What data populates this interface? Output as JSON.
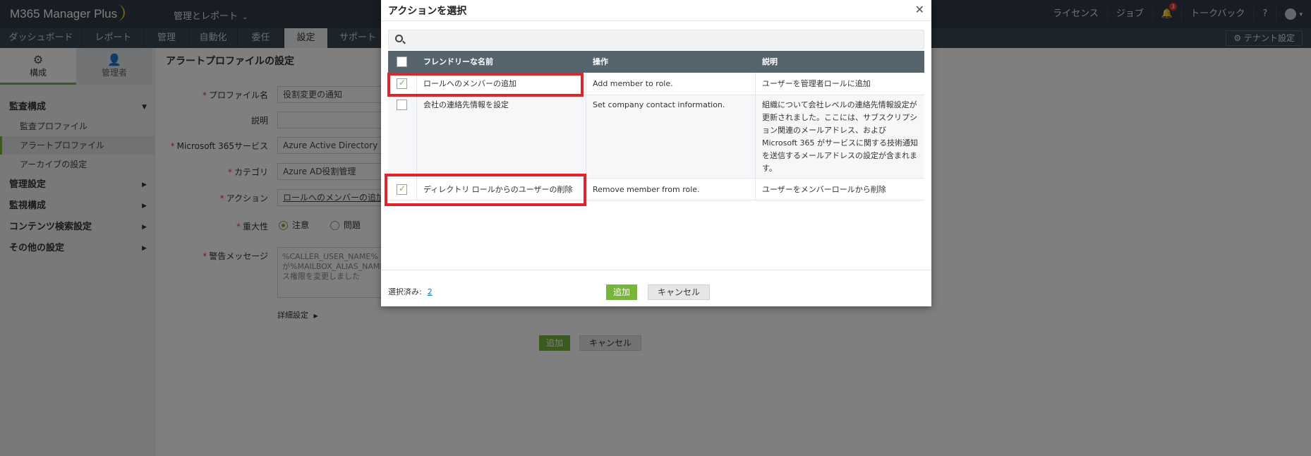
{
  "topbar": {
    "logo": "M365 Manager Plus",
    "main_menu": "管理とレポート",
    "right_items": [
      "ライセンス",
      "ジョブ",
      "トークバック",
      "?"
    ],
    "notification_count": "3"
  },
  "tabs": [
    "ダッシュボード",
    "レポート",
    "管理",
    "自動化",
    "委任",
    "設定",
    "サポート"
  ],
  "active_tab": "設定",
  "tenant_button": "テナント設定",
  "sidebar": {
    "tabs": [
      "構成",
      "管理者"
    ],
    "section_audit": "監査構成",
    "audit_items": [
      "監査プロファイル",
      "アラートプロファイル",
      "アーカイブの設定"
    ],
    "sections": [
      "管理設定",
      "監視構成",
      "コンテンツ検索設定",
      "その他の設定"
    ]
  },
  "form": {
    "title": "アラートプロファイルの設定",
    "labels": {
      "profile_name": "プロファイル名",
      "description": "説明",
      "service": "Microsoft 365サービス",
      "category": "カテゴリ",
      "action": "アクション",
      "severity": "重大性",
      "message": "警告メッセージ"
    },
    "values": {
      "profile_name": "役割変更の通知",
      "description": "",
      "service": "Azure Active Directory",
      "category": "Azure AD役割管理",
      "action": "ロールへのメンバーの追加、..."
    },
    "severity_options": [
      "注意",
      "問題"
    ],
    "message_text": "%CALLER_USER_NAME%が%MAILBOX_ALIAS_NAME%ス権限を変更しました",
    "advanced": "詳細設定",
    "add_button": "追加",
    "cancel_button": "キャンセル"
  },
  "modal": {
    "title": "アクションを選択",
    "search_placeholder": "",
    "columns": [
      "フレンドリーな名前",
      "操作",
      "説明"
    ],
    "rows": [
      {
        "name": "ロールへのメンバーの追加",
        "operation": "Add member to role.",
        "description": "ユーザーを管理者ロールに追加",
        "checked": true
      },
      {
        "name": "会社の連絡先情報を設定",
        "operation": "Set company contact information.",
        "description": "組織について会社レベルの連絡先情報設定が更新されました。ここには、サブスクリプション関連のメールアドレス、およびMicrosoft 365 がサービスに関する技術通知を送信するメールアドレスの設定が含まれます。",
        "checked": false
      },
      {
        "name": "ディレクトリ ロールからのユーザーの削除",
        "operation": "Remove member from role.",
        "description": "ユーザーをメンバーロールから削除",
        "checked": true
      }
    ],
    "selected_label": "選択済み:",
    "selected_count": "2",
    "add_button": "追加",
    "cancel_button": "キャンセル"
  }
}
